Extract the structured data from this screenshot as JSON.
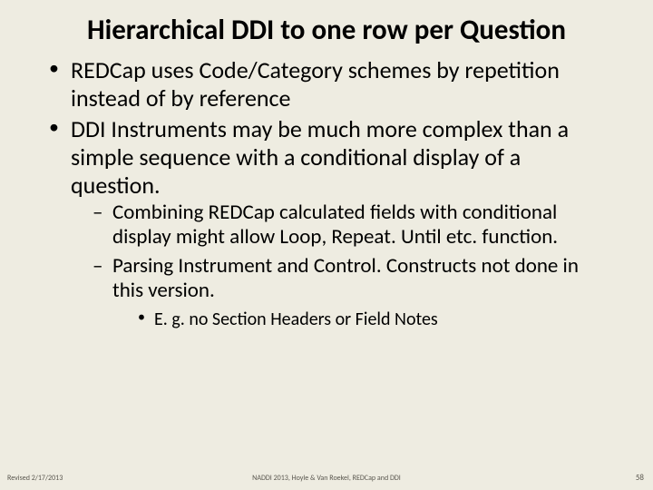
{
  "title": "Hierarchical DDI to one row per Question",
  "bullets": {
    "b1": "REDCap uses Code/Category schemes by repetition instead of by reference",
    "b2": "DDI Instruments may be much more complex than a simple sequence with a conditional display of a question.",
    "b2a": "Combining REDCap calculated fields with conditional display might allow Loop, Repeat. Until etc. function.",
    "b2b": "Parsing Instrument and Control. Constructs not done in this version.",
    "b2b1": "E. g. no Section Headers or Field Notes"
  },
  "footer": {
    "left": "Revised 2/17/2013",
    "center": "NADDI 2013, Hoyle & Van Roekel, REDCap and DDI",
    "right": "58"
  }
}
